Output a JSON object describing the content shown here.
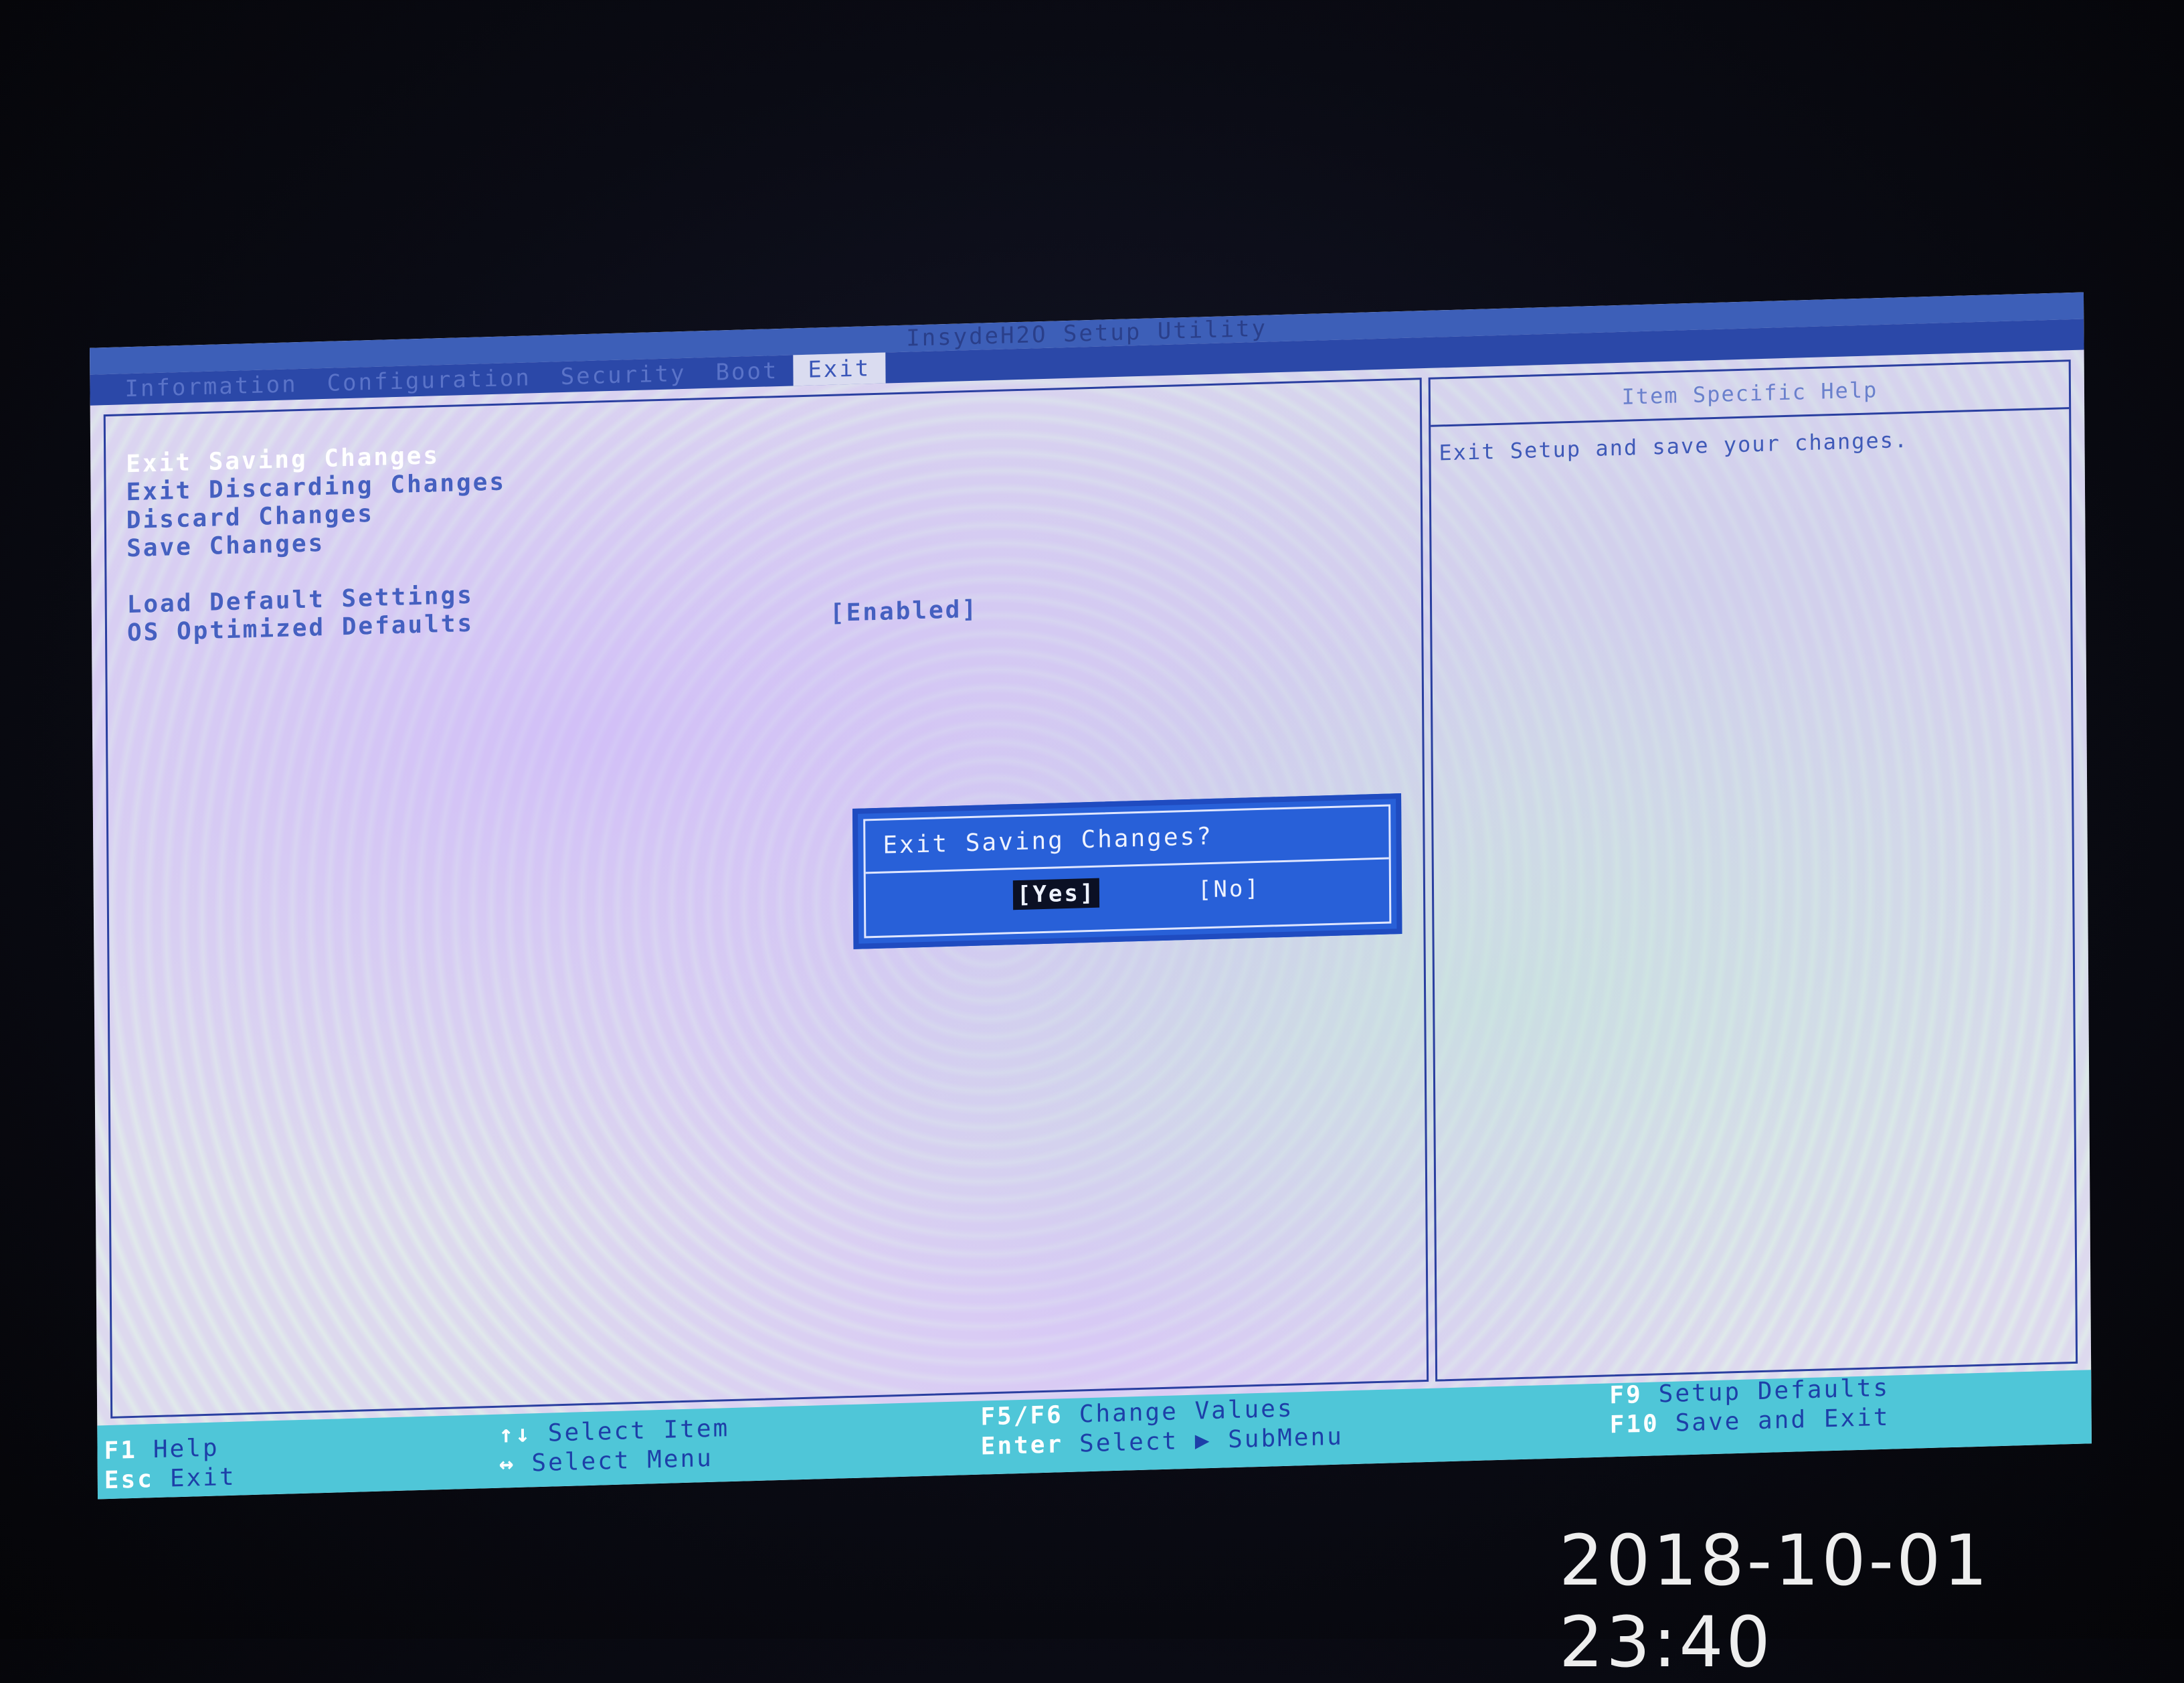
{
  "app": {
    "title": "InsydeH2O Setup Utility"
  },
  "tabs": [
    "Information",
    "Configuration",
    "Security",
    "Boot",
    "Exit"
  ],
  "active_tab": "Exit",
  "menu": {
    "items": [
      {
        "label": "Exit Saving Changes",
        "value": ""
      },
      {
        "label": "Exit Discarding Changes",
        "value": ""
      },
      {
        "label": "Discard Changes",
        "value": ""
      },
      {
        "label": "Save Changes",
        "value": ""
      },
      {
        "label": "Load Default Settings",
        "value": ""
      },
      {
        "label": "OS Optimized Defaults",
        "value": "[Enabled]"
      }
    ],
    "selected": "Exit Saving Changes"
  },
  "help": {
    "title": "Item Specific Help",
    "text": "Exit Setup and save your changes."
  },
  "dialog": {
    "title": "Exit Saving Changes?",
    "yes": "[Yes]",
    "no": "[No]"
  },
  "status": {
    "f1": {
      "key": "F1",
      "desc": "Help"
    },
    "esc": {
      "key": "Esc",
      "desc": "Exit"
    },
    "updown": {
      "key": "↑↓",
      "desc": "Select Item"
    },
    "leftright": {
      "key": "↔",
      "desc": "Select Menu"
    },
    "f5f6": {
      "key": "F5/F6",
      "desc": "Change Values"
    },
    "enter": {
      "key": "Enter",
      "desc": "Select ▶ SubMenu"
    },
    "f9": {
      "key": "F9",
      "desc": "Setup Defaults"
    },
    "f10": {
      "key": "F10",
      "desc": "Save and Exit"
    }
  },
  "photo_timestamp": "2018-10-01  23:40",
  "colors": {
    "title_bar": "#3d5fb8",
    "menu_bar": "#2b48a8",
    "dialog": "#2860d8",
    "status_bar": "#4fc6d8",
    "text_blue": "#4560c0"
  }
}
